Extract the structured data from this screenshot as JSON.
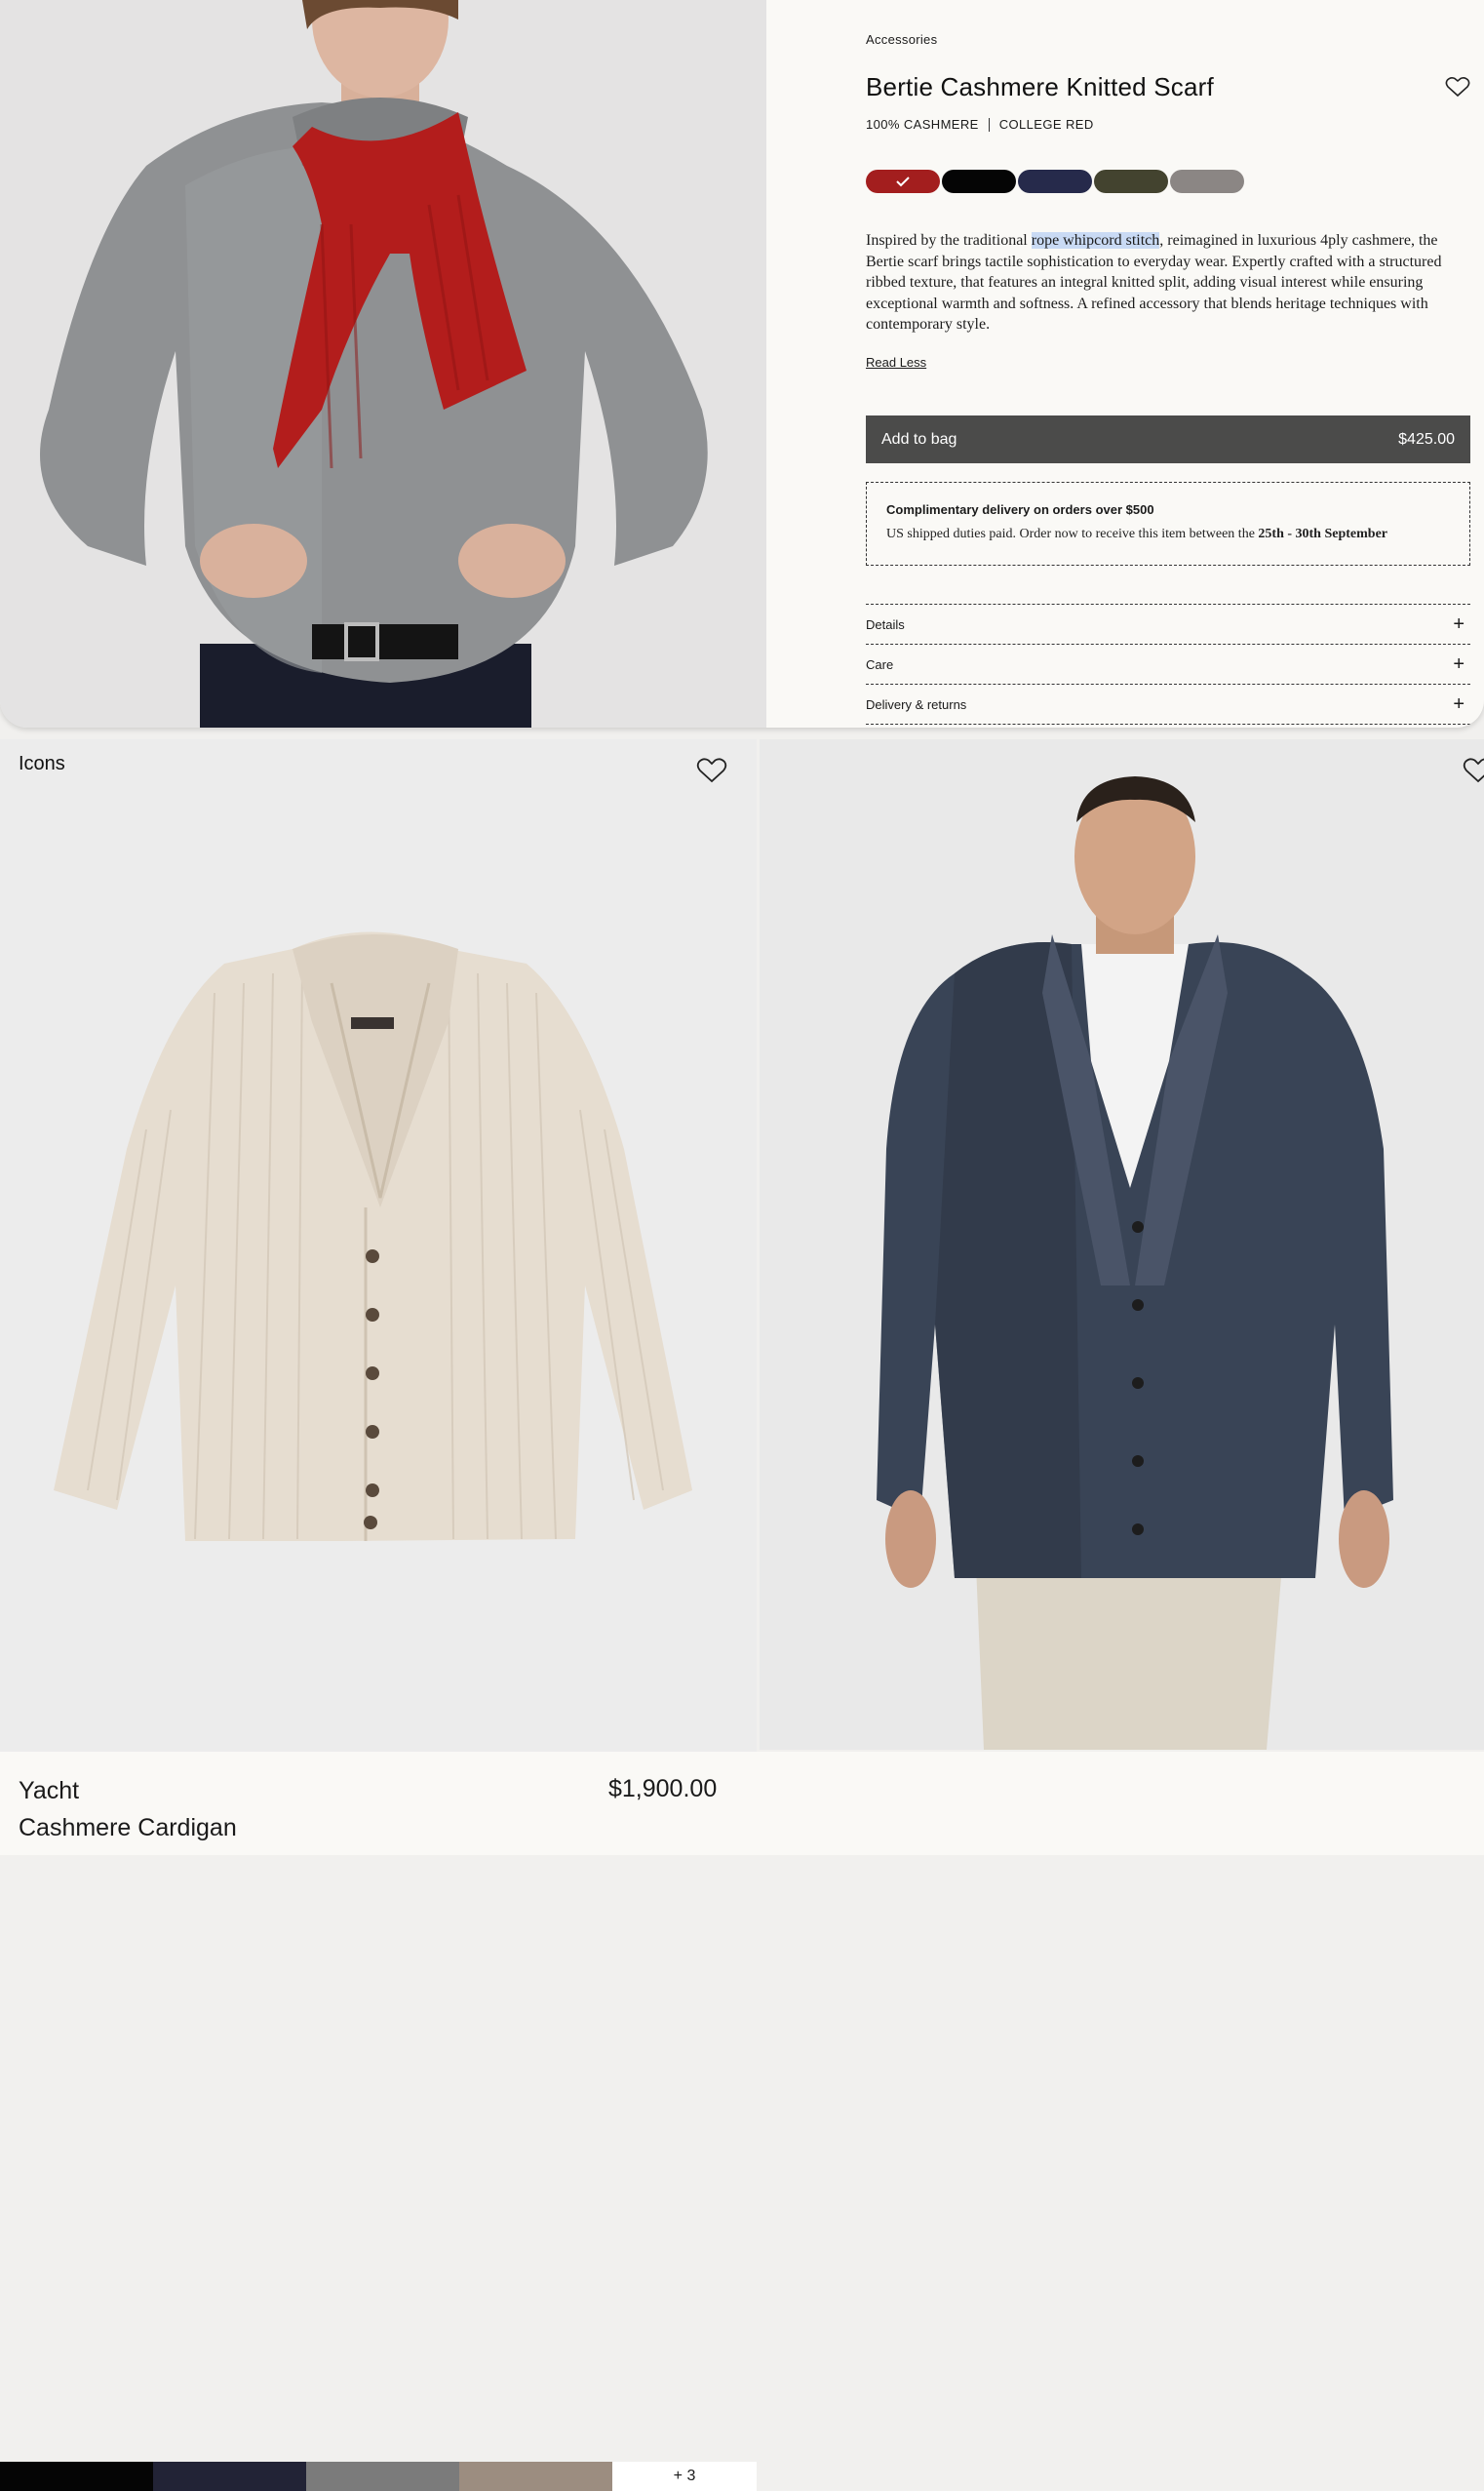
{
  "product": {
    "category": "Accessories",
    "title": "Bertie Cashmere Knitted Scarf",
    "composition": "100% CASHMERE",
    "color_name": "COLLEGE RED",
    "swatches": [
      {
        "color": "#a31e1e",
        "selected": true
      },
      {
        "color": "#050505",
        "selected": false
      },
      {
        "color": "#262a4b",
        "selected": false
      },
      {
        "color": "#43432f",
        "selected": false
      },
      {
        "color": "#8b8684",
        "selected": false
      }
    ],
    "description_pre": "Inspired by the traditional ",
    "description_highlight": "rope whipcord stitch",
    "description_post": ", reimagined in luxurious 4ply cashmere, the Bertie scarf brings tactile sophistication to everyday wear. Expertly crafted with a structured ribbed texture, that features an integral knitted split, adding visual interest while ensuring exceptional warmth and softness. A refined accessory that blends heritage techniques with contemporary style.",
    "read_less": "Read Less",
    "add_to_bag": "Add to bag",
    "price": "$425.00",
    "delivery_title": "Complimentary delivery on orders over $500",
    "delivery_text_pre": "US shipped duties paid. Order now to receive this item between the ",
    "delivery_dates": "25th - 30th September",
    "accordion": [
      "Details",
      "Care",
      "Delivery & returns"
    ]
  },
  "grid": {
    "section_label": "Icons",
    "item": {
      "name_line1": "Yacht",
      "name_line2": "Cashmere Cardigan",
      "price": "$1,900.00",
      "colors": [
        "#050505",
        "#222336",
        "#7b7b7b",
        "#9c8d80"
      ],
      "more_colors": "+ 3"
    }
  }
}
